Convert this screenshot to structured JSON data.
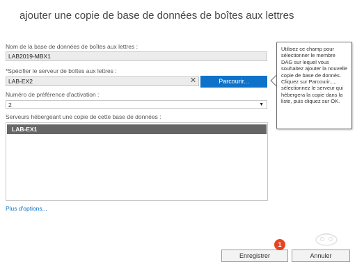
{
  "dialog": {
    "title": "ajouter une copie de base de données de boîtes aux lettres"
  },
  "form": {
    "db_name_label": "Nom de la base de données de boîtes aux lettres :",
    "db_name_value": "LAB2019-MBX1",
    "server_label": "*Spécifier le serveur de boîtes aux lettres :",
    "server_value": "LAB-EX2",
    "clear_symbol": "✕",
    "browse_label": "Parcourir...",
    "activation_label": "Numéro de préférence d'activation :",
    "activation_value": "2",
    "servers_label": "Serveurs hébergeant une copie de cette base de données :",
    "servers": [
      "LAB-EX1"
    ],
    "more_options": "Plus d'options..."
  },
  "tooltip": {
    "text": "Utilisez ce champ pour sélectionner le membre DAG sur lequel vous souhaitez ajouter la nouvelle copie de base de donnés. Cliquez sur Parcourir..., sélectionnez le serveur qui hébergera la copie dans la liste, puis cliquez sur OK."
  },
  "footer": {
    "save_label": "Enregistrer",
    "cancel_label": "Annuler"
  },
  "annotation": {
    "badge_number": "1",
    "badge_color": "#e8441f"
  },
  "colors": {
    "accent": "#0f72c9",
    "selected_row": "#666666"
  },
  "icons": {
    "clear": "close-icon",
    "dropdown": "chevron-down-icon"
  }
}
